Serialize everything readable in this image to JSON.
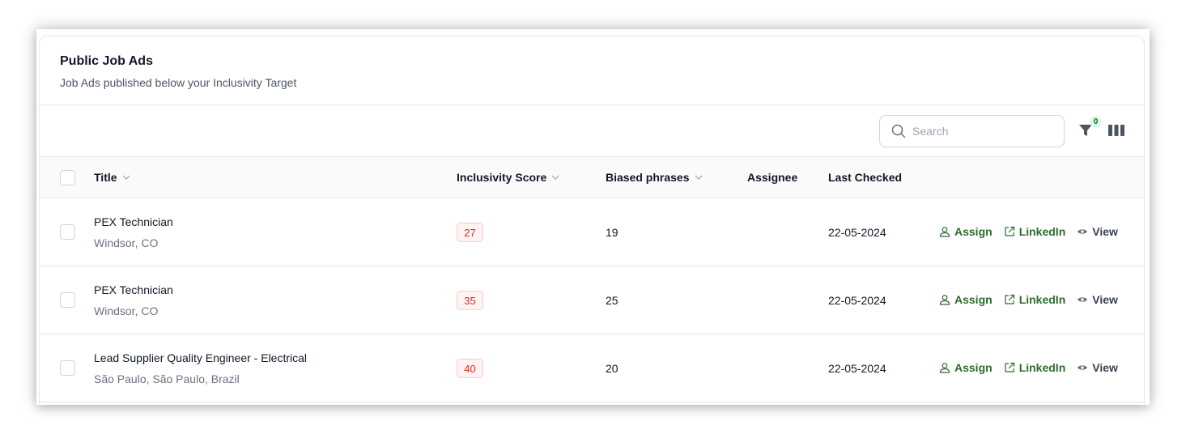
{
  "card": {
    "title": "Public Job Ads",
    "subtitle": "Job Ads published below your Inclusivity Target"
  },
  "toolbar": {
    "search_placeholder": "Search",
    "filter_count": "0",
    "icons": {
      "search": "search-icon",
      "filter": "filter-icon",
      "columns": "columns-icon"
    }
  },
  "table": {
    "columns": {
      "title": "Title",
      "score": "Inclusivity Score",
      "biased": "Biased phrases",
      "assignee": "Assignee",
      "last_checked": "Last Checked"
    },
    "actions": {
      "assign": "Assign",
      "linkedin": "LinkedIn",
      "view": "View"
    },
    "rows": [
      {
        "title": "PEX Technician",
        "location": "Windsor, CO",
        "score": "27",
        "biased": "19",
        "assignee": "",
        "last_checked": "22-05-2024"
      },
      {
        "title": "PEX Technician",
        "location": "Windsor, CO",
        "score": "35",
        "biased": "25",
        "assignee": "",
        "last_checked": "22-05-2024"
      },
      {
        "title": "Lead Supplier Quality Engineer - Electrical",
        "location": "São Paulo, São Paulo, Brazil",
        "score": "40",
        "biased": "20",
        "assignee": "",
        "last_checked": "22-05-2024"
      }
    ]
  },
  "colors": {
    "action_green": "#2f6b2f",
    "score_red": "#dc2626",
    "score_bg": "#fef2f2",
    "badge_green_bg": "#dcfce7"
  }
}
